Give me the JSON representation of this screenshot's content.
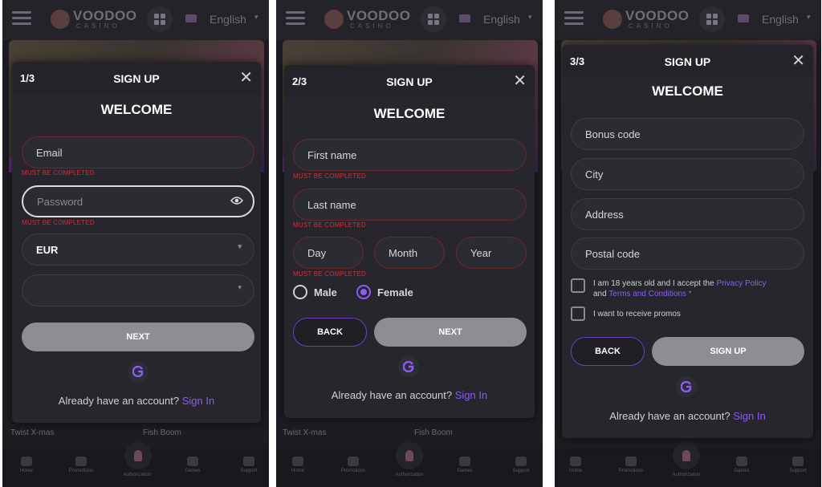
{
  "header": {
    "logo_text": "VOODOO",
    "logo_sub": "CASINO",
    "language": "English"
  },
  "background": {
    "games": [
      "Twist X-mas",
      "Fish Boom"
    ],
    "nav": [
      "Home",
      "Promotions",
      "Authorization",
      "Games",
      "Support"
    ]
  },
  "common": {
    "signup_title": "SIGN UP",
    "welcome": "WELCOME",
    "already": "Already have an account?",
    "signin": "Sign In",
    "error": "MUST BE COMPLETED"
  },
  "step1": {
    "step": "1/3",
    "email_placeholder": "Email",
    "password_placeholder": "Password",
    "currency": "EUR",
    "next": "NEXT"
  },
  "step2": {
    "step": "2/3",
    "first_name": "First name",
    "last_name": "Last name",
    "day": "Day",
    "month": "Month",
    "year": "Year",
    "male": "Male",
    "female": "Female",
    "back": "BACK",
    "next": "NEXT"
  },
  "step3": {
    "step": "3/3",
    "bonus_code": "Bonus code",
    "city": "City",
    "address": "Address",
    "postal_code": "Postal code",
    "terms_pre": "I am 18 years old and I accept the",
    "privacy": "Privacy Policy",
    "and": "and",
    "terms": "Terms and Conditions",
    "required": "*",
    "promos": "I want to receive promos",
    "back": "BACK",
    "signup_btn": "SIGN UP"
  },
  "colors": {
    "accent": "#8b5cf6",
    "error": "#d42d3a",
    "panel_bg": "#1c1c22",
    "modal_bg": "#26262c",
    "button_grey": "#8e8e92"
  }
}
